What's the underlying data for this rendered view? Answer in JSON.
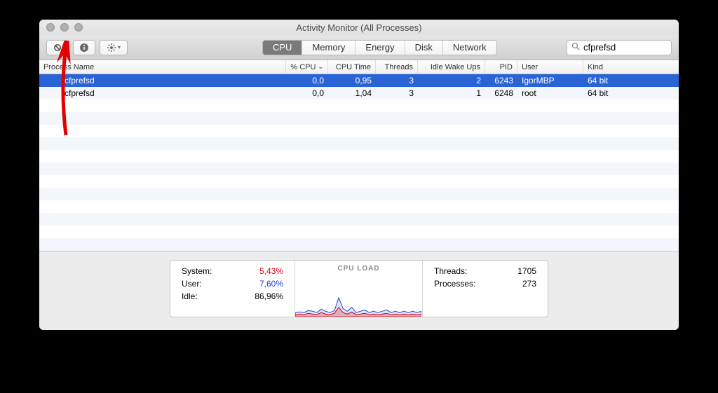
{
  "window": {
    "title": "Activity Monitor (All Processes)"
  },
  "toolbar": {
    "tabs": [
      "CPU",
      "Memory",
      "Energy",
      "Disk",
      "Network"
    ],
    "active_tab": 0,
    "search_value": "cfprefsd"
  },
  "columns": {
    "name": "Process Name",
    "cpu": "% CPU",
    "time": "CPU Time",
    "threads": "Threads",
    "wake": "Idle Wake Ups",
    "pid": "PID",
    "user": "User",
    "kind": "Kind"
  },
  "rows": [
    {
      "name": "cfprefsd",
      "cpu": "0,0",
      "time": "0,95",
      "threads": "3",
      "wake": "2",
      "pid": "6243",
      "user": "IgorMBP",
      "kind": "64 bit",
      "selected": true
    },
    {
      "name": "cfprefsd",
      "cpu": "0,0",
      "time": "1,04",
      "threads": "3",
      "wake": "1",
      "pid": "6248",
      "user": "root",
      "kind": "64 bit",
      "selected": false
    }
  ],
  "stats": {
    "system_label": "System:",
    "system_value": "5,43%",
    "user_label": "User:",
    "user_value": "7,60%",
    "idle_label": "Idle:",
    "idle_value": "86,96%",
    "chart_title": "CPU LOAD",
    "threads_label": "Threads:",
    "threads_value": "1705",
    "processes_label": "Processes:",
    "processes_value": "273"
  },
  "chart_data": {
    "type": "area",
    "title": "CPU LOAD",
    "xlabel": "",
    "ylabel": "",
    "ylim": [
      0,
      50
    ],
    "series": [
      {
        "name": "System",
        "color": "#d9000a",
        "values": [
          3,
          4,
          3,
          5,
          4,
          3,
          6,
          4,
          3,
          5,
          14,
          6,
          4,
          7,
          3,
          4,
          5,
          3,
          4,
          3,
          4,
          5,
          3,
          4,
          3,
          4,
          3,
          4,
          3,
          4
        ]
      },
      {
        "name": "User",
        "color": "#1a3fd7",
        "values": [
          6,
          7,
          6,
          9,
          8,
          6,
          11,
          8,
          6,
          9,
          28,
          12,
          8,
          14,
          6,
          8,
          10,
          6,
          8,
          6,
          8,
          10,
          6,
          8,
          6,
          8,
          6,
          8,
          6,
          8
        ]
      }
    ]
  }
}
